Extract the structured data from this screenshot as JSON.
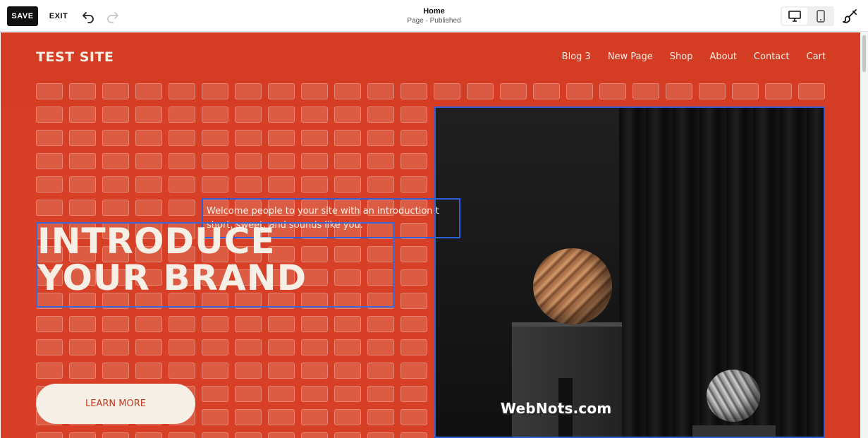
{
  "toolbar": {
    "save_label": "SAVE",
    "exit_label": "EXIT",
    "undo_icon": "undo-icon",
    "redo_icon": "redo-icon",
    "page_name": "Home",
    "page_status": "Page · Published",
    "device_desktop_icon": "desktop-icon",
    "device_mobile_icon": "mobile-icon",
    "design_icon": "paintbrush-icon"
  },
  "site": {
    "title": "TEST SITE",
    "nav": [
      "Blog 3",
      "New Page",
      "Shop",
      "About",
      "Contact",
      "Cart"
    ],
    "intro_lines": [
      "Welcome people to your site with an introduction th",
      "short, sweet, and sounds like you."
    ],
    "heading_lines": [
      "INTRODUCE",
      "YOUR BRAND"
    ],
    "cta_label": "LEARN MORE",
    "watermark": "WebNots.com"
  },
  "colors": {
    "site_background": "#d43c23",
    "site_text": "#f6efe6",
    "selection_outline": "#2f5fd6",
    "save_button": "#111111"
  }
}
